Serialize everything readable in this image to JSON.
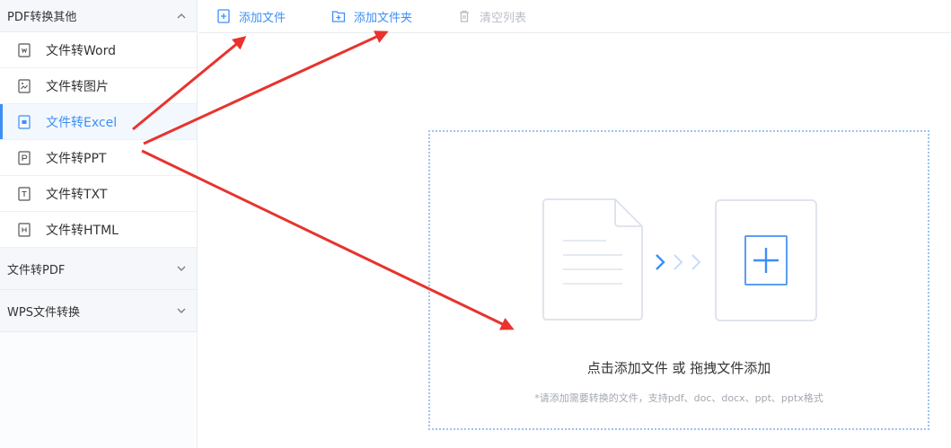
{
  "sidebar": {
    "groups": [
      {
        "title": "PDF转换其他",
        "expanded": true,
        "items": [
          {
            "label": "文件转Word",
            "icon": "word-file-icon"
          },
          {
            "label": "文件转图片",
            "icon": "image-file-icon"
          },
          {
            "label": "文件转Excel",
            "icon": "excel-file-icon",
            "active": true
          },
          {
            "label": "文件转PPT",
            "icon": "ppt-file-icon"
          },
          {
            "label": "文件转TXT",
            "icon": "txt-file-icon"
          },
          {
            "label": "文件转HTML",
            "icon": "html-file-icon"
          }
        ]
      },
      {
        "title": "文件转PDF",
        "expanded": false
      },
      {
        "title": "WPS文件转换",
        "expanded": false
      }
    ]
  },
  "toolbar": {
    "add_file": "添加文件",
    "add_folder": "添加文件夹",
    "clear_list": "清空列表"
  },
  "dropzone": {
    "main_hint": "点击添加文件 或 拖拽文件添加",
    "sub_hint": "*请添加需要转换的文件，支持pdf、doc、docx、ppt、pptx格式"
  },
  "colors": {
    "accent": "#3d8ff5",
    "annotation_arrow": "#e8332e",
    "disabled": "#b9bec6"
  }
}
